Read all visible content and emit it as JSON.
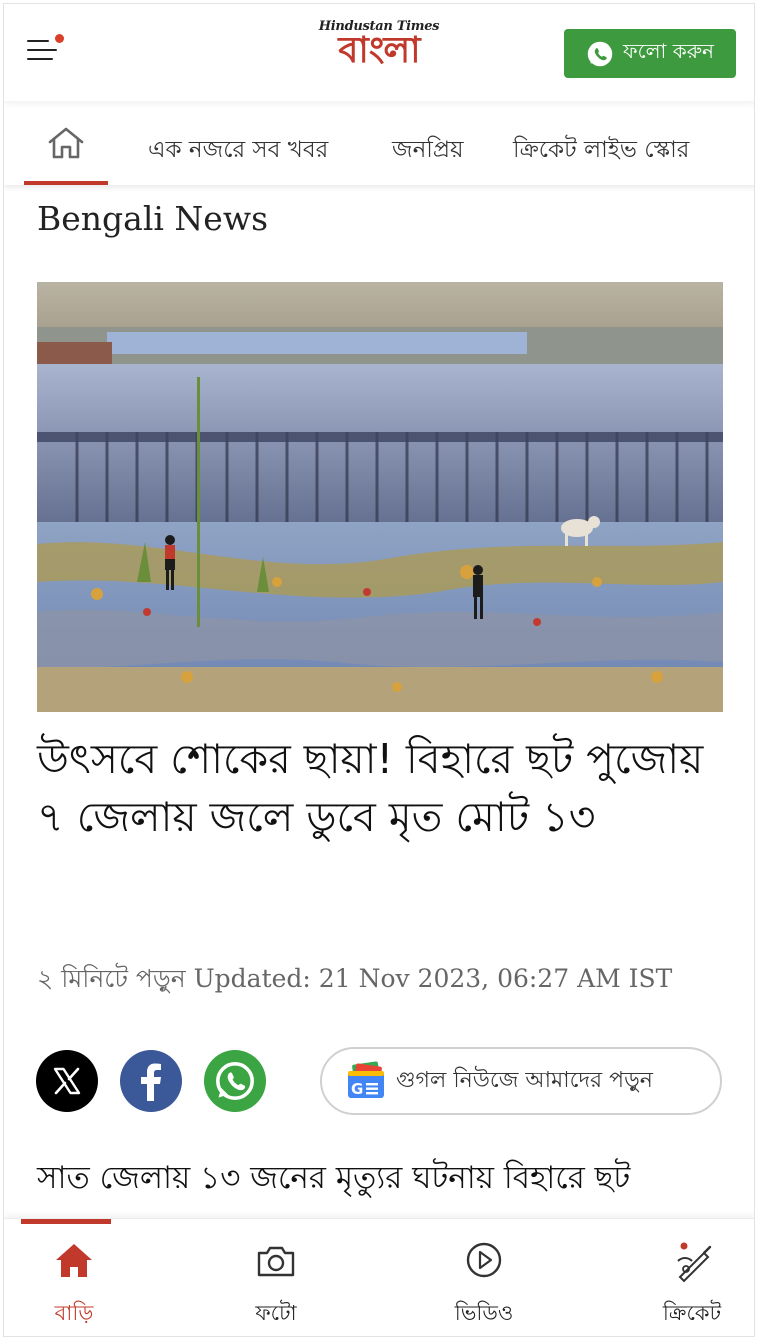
{
  "header": {
    "logo_top": "Hindustan Times",
    "logo_main": "বাংলা",
    "follow_label": "ফলো করুন"
  },
  "nav": {
    "items": [
      {
        "label": "এক নজরে সব খবর"
      },
      {
        "label": "জনপ্রিয়"
      },
      {
        "label": "ক্রিকেট লাইভ স্কোর"
      }
    ]
  },
  "article": {
    "section": "Bengali News",
    "headline": "উৎসবে শোকের ছায়া! বিহারে ছট পুজোয় ৭ জেলায় জলে ডুবে মৃত মোট ১৩",
    "meta": "২ মিনিটে পড়ুন Updated: 21 Nov 2023, 06:27 AM IST",
    "google_news_label": "গুগল নিউজে আমাদের পড়ুন",
    "body_first_line": "সাত জেলায় ১৩ জনের মৃত্যুর ঘটনায় বিহারে ছট"
  },
  "bottom_nav": {
    "items": [
      {
        "label": "বাড়ি"
      },
      {
        "label": "ফটো"
      },
      {
        "label": "ভিডিও"
      },
      {
        "label": "ক্রিকেট"
      }
    ]
  },
  "colors": {
    "accent": "#c0392b",
    "whatsapp_green": "#3e9a3e",
    "facebook_blue": "#3b5998",
    "x_black": "#000000"
  },
  "icons": [
    "menu-icon",
    "whatsapp-icon",
    "home-icon",
    "x-icon",
    "facebook-icon",
    "google-news-icon",
    "camera-icon",
    "play-icon",
    "cricket-icon"
  ]
}
